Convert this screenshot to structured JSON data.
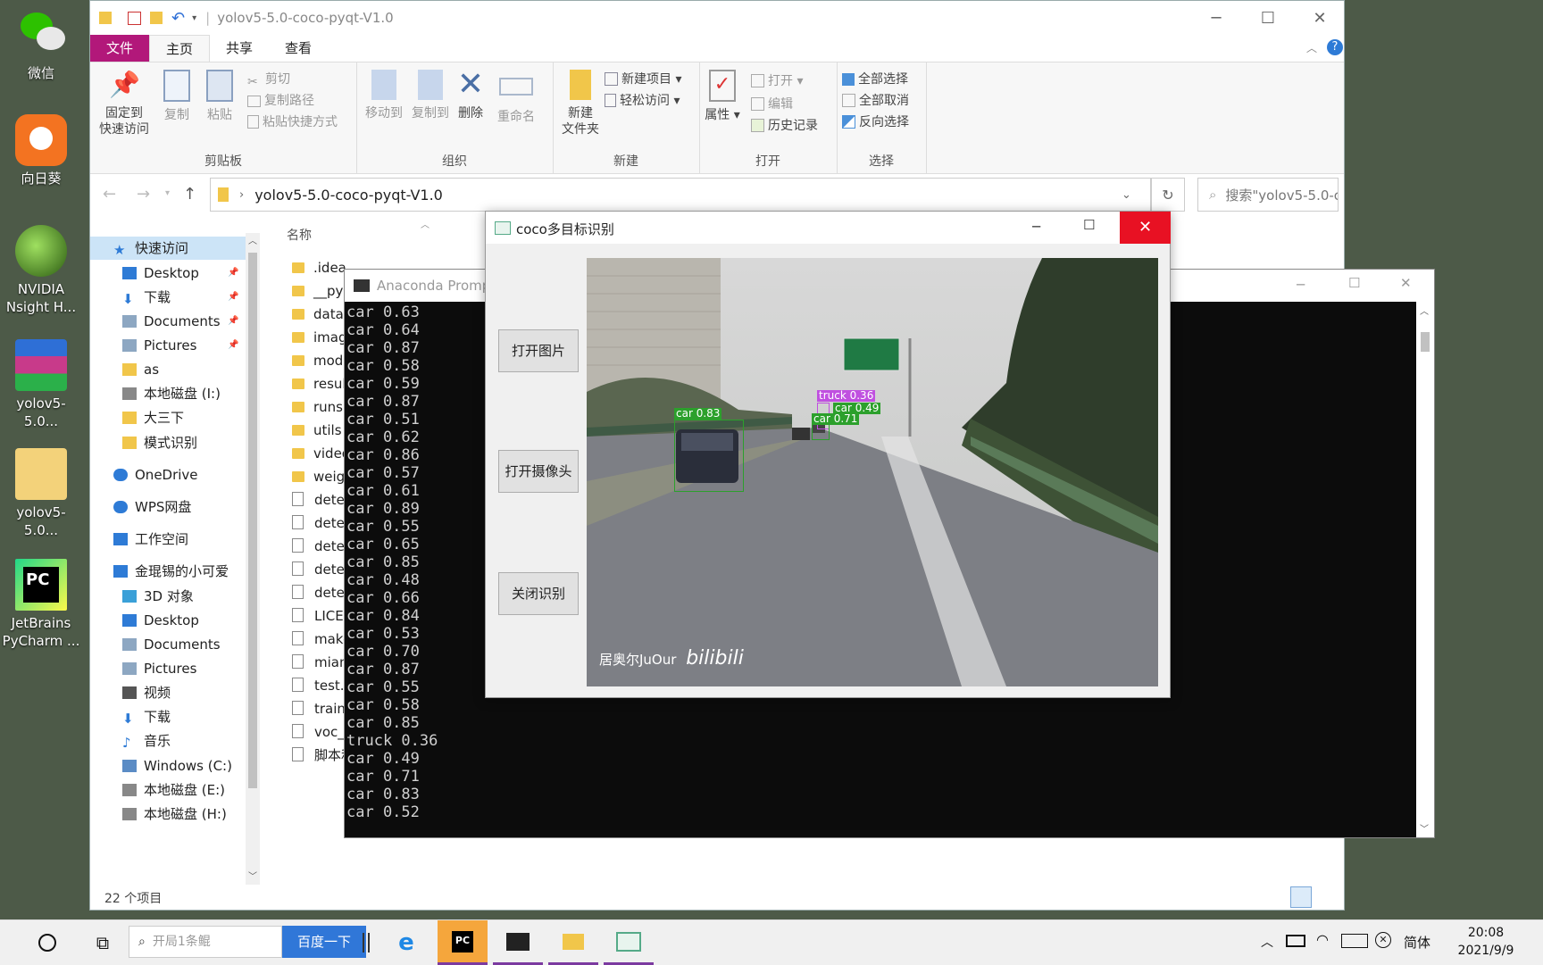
{
  "desktop": {
    "icons": [
      {
        "label": "微信",
        "icon": "wechat-icon",
        "color": "#2dc100"
      },
      {
        "label": "向日葵",
        "icon": "sunflower-icon",
        "color": "#f37321"
      },
      {
        "label": "NVIDIA Nsight H...",
        "icon": "nvidia-icon",
        "color": "#76b900"
      },
      {
        "label": "yolov5-5.0...",
        "icon": "winrar-icon",
        "color": "#2e6fd6"
      },
      {
        "label": "yolov5-5.0...",
        "icon": "folder-icon",
        "color": "#f3d27a"
      },
      {
        "label": "JetBrains PyCharm ...",
        "icon": "pycharm-icon",
        "color": "#21d789"
      }
    ]
  },
  "explorer": {
    "title": "yolov5-5.0-coco-pyqt-V1.0",
    "menu": {
      "file": "文件",
      "home": "主页",
      "share": "共享",
      "view": "查看"
    },
    "ribbon": {
      "clipboard": {
        "group": "剪贴板",
        "pin": "固定到\n快速访问",
        "copy": "复制",
        "paste": "粘贴",
        "cut": "剪切",
        "copy_path": "复制路径",
        "paste_shortcut": "粘贴快捷方式"
      },
      "organize": {
        "group": "组织",
        "move_to": "移动到",
        "copy_to": "复制到",
        "delete": "删除",
        "rename": "重命名"
      },
      "new": {
        "group": "新建",
        "new_item": "新建项目",
        "easy_access": "轻松访问",
        "new_folder": "新建\n文件夹"
      },
      "open": {
        "group": "打开",
        "properties": "属性",
        "open": "打开",
        "edit": "编辑",
        "history": "历史记录"
      },
      "select": {
        "group": "选择",
        "select_all": "全部选择",
        "select_none": "全部取消",
        "invert": "反向选择"
      }
    },
    "address": {
      "path": "yolov5-5.0-coco-pyqt-V1.0",
      "search_placeholder": "搜索\"yolov5-5.0-coco-py..."
    },
    "nav": [
      {
        "label": "快速访问",
        "icon": "star-icon",
        "color": "#2e7bd6",
        "indent": 0
      },
      {
        "label": "Desktop",
        "icon": "desktop-icon",
        "color": "#2e7bd6",
        "indent": 1,
        "pinned": true
      },
      {
        "label": "下载",
        "icon": "download-icon",
        "color": "#2e7bd6",
        "indent": 1,
        "pinned": true
      },
      {
        "label": "Documents",
        "icon": "documents-icon",
        "color": "#8da7c2",
        "indent": 1,
        "pinned": true
      },
      {
        "label": "Pictures",
        "icon": "pictures-icon",
        "color": "#8da7c2",
        "indent": 1,
        "pinned": true
      },
      {
        "label": "as",
        "icon": "folder-icon",
        "color": "#f1c64a",
        "indent": 1
      },
      {
        "label": "本地磁盘 (I:)",
        "icon": "drive-icon",
        "color": "#888888",
        "indent": 1
      },
      {
        "label": "大三下",
        "icon": "folder-icon",
        "color": "#f1c64a",
        "indent": 1
      },
      {
        "label": "模式识别",
        "icon": "folder-icon",
        "color": "#f1c64a",
        "indent": 1
      },
      {
        "label": "OneDrive",
        "icon": "cloud-icon",
        "color": "#2e7bd6",
        "indent": 0
      },
      {
        "label": "WPS网盘",
        "icon": "cloud-icon",
        "color": "#2e7bd6",
        "indent": 0
      },
      {
        "label": "工作空间",
        "icon": "workspace-icon",
        "color": "#2e7bd6",
        "indent": 0
      },
      {
        "label": "金琨锡的小可爱",
        "icon": "computer-icon",
        "color": "#2e7bd6",
        "indent": 0
      },
      {
        "label": "3D 对象",
        "icon": "cube-icon",
        "color": "#3aa0d8",
        "indent": 1
      },
      {
        "label": "Desktop",
        "icon": "desktop-icon",
        "color": "#2e7bd6",
        "indent": 1
      },
      {
        "label": "Documents",
        "icon": "documents-icon",
        "color": "#8da7c2",
        "indent": 1
      },
      {
        "label": "Pictures",
        "icon": "pictures-icon",
        "color": "#8da7c2",
        "indent": 1
      },
      {
        "label": "视频",
        "icon": "video-icon",
        "color": "#555555",
        "indent": 1
      },
      {
        "label": "下载",
        "icon": "download-icon",
        "color": "#2e7bd6",
        "indent": 1
      },
      {
        "label": "音乐",
        "icon": "music-icon",
        "color": "#2e7bd6",
        "indent": 1
      },
      {
        "label": "Windows (C:)",
        "icon": "drive-icon",
        "color": "#5b8cc5",
        "indent": 1
      },
      {
        "label": "本地磁盘 (E:)",
        "icon": "drive-icon",
        "color": "#888888",
        "indent": 1
      },
      {
        "label": "本地磁盘 (H:)",
        "icon": "drive-icon",
        "color": "#888888",
        "indent": 1
      }
    ],
    "column_name": "名称",
    "files": [
      {
        "name": ".idea",
        "type": "folder"
      },
      {
        "name": "__pyc",
        "type": "folder"
      },
      {
        "name": "data",
        "type": "folder"
      },
      {
        "name": "imag",
        "type": "folder"
      },
      {
        "name": "mode",
        "type": "folder"
      },
      {
        "name": "resul",
        "type": "folder"
      },
      {
        "name": "runs",
        "type": "folder"
      },
      {
        "name": "utils",
        "type": "folder"
      },
      {
        "name": "video",
        "type": "folder"
      },
      {
        "name": "weig",
        "type": "folder"
      },
      {
        "name": "dete",
        "type": "file"
      },
      {
        "name": "dete",
        "type": "file"
      },
      {
        "name": "dete",
        "type": "file"
      },
      {
        "name": "dete",
        "type": "file"
      },
      {
        "name": "dete",
        "type": "file"
      },
      {
        "name": "LICEN",
        "type": "file"
      },
      {
        "name": "make",
        "type": "file"
      },
      {
        "name": "mian.",
        "type": "file"
      },
      {
        "name": "test.p",
        "type": "file"
      },
      {
        "name": "train.",
        "type": "file"
      },
      {
        "name": "voc_l",
        "type": "file"
      },
      {
        "name": "脚本和",
        "type": "file"
      }
    ],
    "status": "22 个项目"
  },
  "console": {
    "title": "Anaconda Promp",
    "lines": [
      "car 0.63",
      "car 0.64",
      "car 0.87",
      "car 0.58",
      "car 0.59",
      "car 0.87",
      "car 0.51",
      "car 0.62",
      "car 0.86",
      "car 0.57",
      "car 0.61",
      "car 0.89",
      "car 0.55",
      "car 0.65",
      "car 0.85",
      "car 0.48",
      "car 0.66",
      "car 0.84",
      "car 0.53",
      "car 0.70",
      "car 0.87",
      "car 0.55",
      "car 0.58",
      "car 0.85",
      "truck 0.36",
      "car 0.49",
      "car 0.71",
      "car 0.83",
      "car 0.52"
    ]
  },
  "coco": {
    "title": "coco多目标识别",
    "buttons": {
      "open_image": "打开图片",
      "open_camera": "打开摄像头",
      "close_detect": "关闭识别"
    },
    "detections": [
      {
        "label": "car 0.83",
        "color": "#2ca02c"
      },
      {
        "label": "truck 0.36",
        "color": "#c050e0"
      },
      {
        "label": "car 0.49",
        "color": "#2ca02c"
      },
      {
        "label": "car 0.71",
        "color": "#2ca02c"
      }
    ],
    "watermark": "居奥尔JuOur",
    "watermark_logo": "bilibili"
  },
  "taskbar": {
    "search_placeholder": "开局1条鲲",
    "search_button": "百度一下",
    "ime": "简体",
    "time": "20:08",
    "date": "2021/9/9"
  }
}
